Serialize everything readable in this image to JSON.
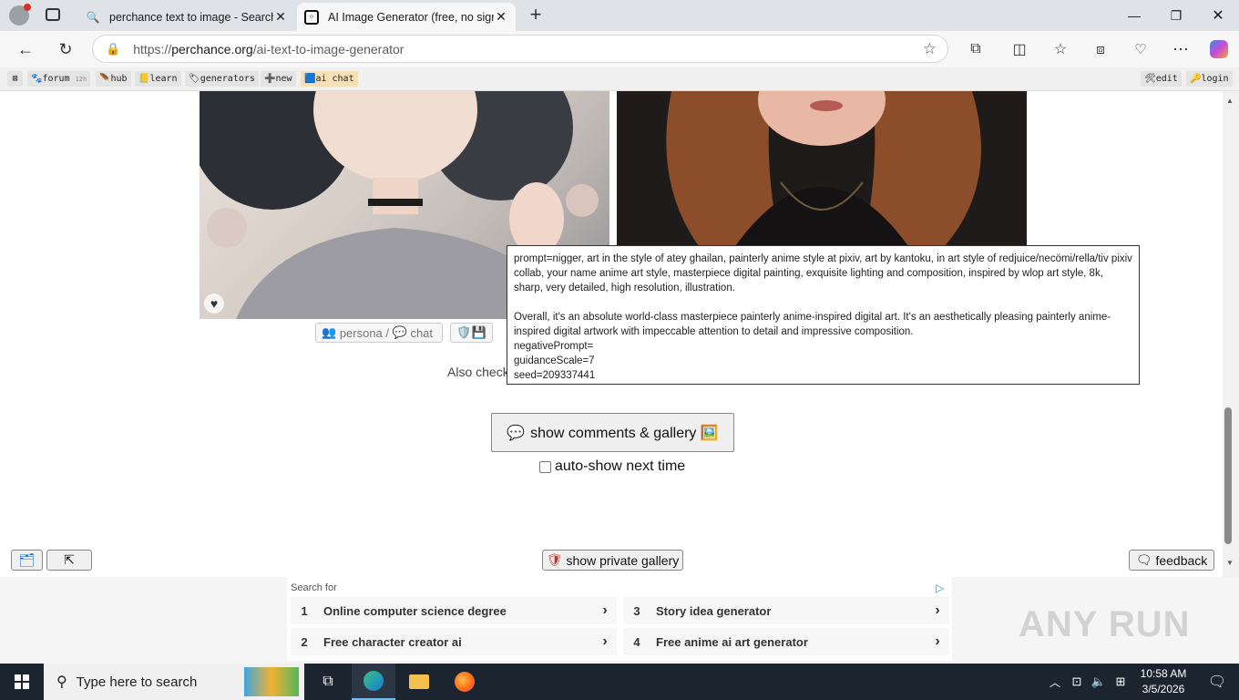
{
  "browser": {
    "tabs": [
      {
        "title": "perchance text to image - Search",
        "icon": "search-icon"
      },
      {
        "title": "AI Image Generator (free, no sign",
        "icon": "dice-icon"
      }
    ],
    "url_prefix": "https://",
    "url_host": "perchance.org",
    "url_path": "/ai-text-to-image-generator"
  },
  "perchance_bar": {
    "items": [
      {
        "label": "forum",
        "badge": "12h"
      },
      {
        "label": "hub"
      },
      {
        "label": "learn"
      },
      {
        "label": "generators"
      },
      {
        "label": "new"
      },
      {
        "label": "ai chat"
      }
    ],
    "right_items": [
      {
        "label": "edit"
      },
      {
        "label": "login"
      }
    ]
  },
  "image_card": {
    "persona_label": "persona",
    "chat_label": "chat",
    "also_check": "Also check"
  },
  "tooltip": {
    "line1": "prompt=nigger, art in the style of atey ghailan, painterly anime style at pixiv, art by kantoku, in art style of redjuice/necömi/rella/tiv pixiv collab, your name anime art style, masterpiece digital painting, exquisite lighting and composition, inspired by wlop art style, 8k, sharp, very detailed, high resolution, illustration.",
    "line2": "Overall, it's an absolute world-class masterpiece painterly anime-inspired digital art. It's an aesthetically pleasing painterly anime-inspired digital artwork with impeccable attention to detail and impressive composition.",
    "negative": "negativePrompt=",
    "guidance": "guidanceScale=7",
    "seed": "seed=209337441"
  },
  "gallery": {
    "show_button": "show comments & gallery 🖼️",
    "autoshow_label": "auto-show next time"
  },
  "bottom_bar": {
    "private_gallery": "show private gallery",
    "feedback": "feedback"
  },
  "ads": {
    "search_for": "Search for",
    "items": [
      {
        "num": "1",
        "text": "Online computer science degree"
      },
      {
        "num": "3",
        "text": "Story idea generator"
      },
      {
        "num": "2",
        "text": "Free character creator ai"
      },
      {
        "num": "4",
        "text": "Free anime ai art generator"
      }
    ]
  },
  "taskbar": {
    "search_placeholder": "Type here to search",
    "time": "10:58 AM",
    "date": "3/5/2026"
  },
  "watermark": "ANY RUN"
}
